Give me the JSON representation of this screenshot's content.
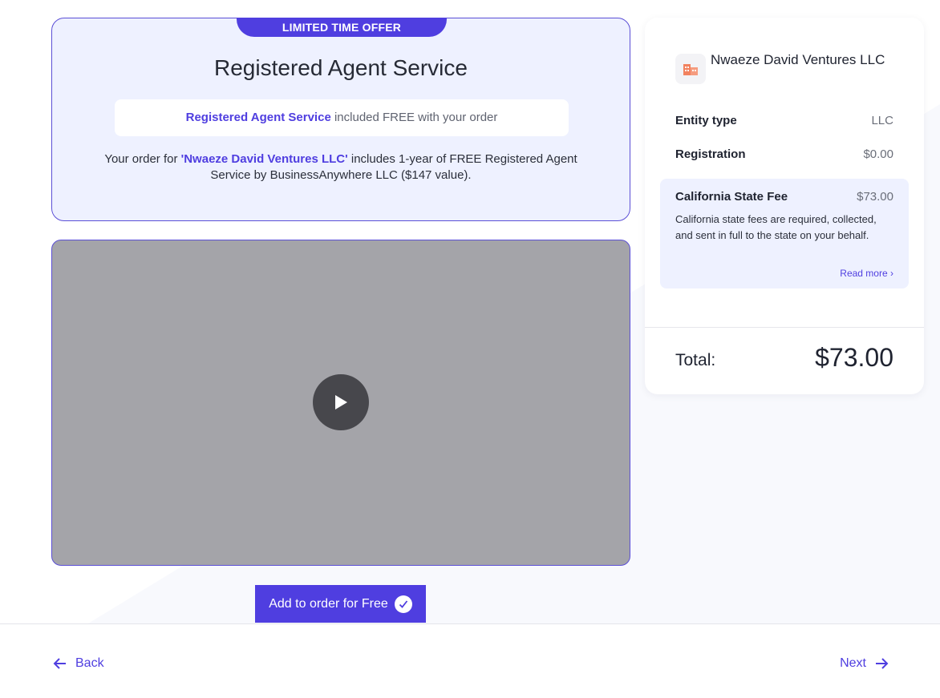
{
  "offer": {
    "ribbon": "LIMITED TIME OFFER",
    "title": "Registered Agent Service",
    "pill_highlight": "Registered Agent Service",
    "pill_rest": " included FREE with your order",
    "desc_before": "Your order for ",
    "desc_company": "'Nwaeze David Ventures LLC'",
    "desc_after": " includes 1-year of FREE Registered Agent Service by BusinessAnywhere LLC ($147 value)."
  },
  "video": {
    "play_icon": "play-icon"
  },
  "add_button": {
    "label": "Add to order for Free",
    "icon": "check-icon"
  },
  "summary": {
    "company_icon": "building-icon",
    "company_name": "Nwaeze David Ventures LLC",
    "rows": [
      {
        "label": "Entity type",
        "value": "LLC"
      },
      {
        "label": "Registration",
        "value": "$0.00"
      }
    ],
    "fee": {
      "label": "California State Fee",
      "value": "$73.00",
      "description": "California state fees are required, collected, and sent in full to the state on your behalf.",
      "read_more": "Read more"
    },
    "total_label": "Total:",
    "total_value": "$73.00"
  },
  "footer": {
    "back_label": "Back",
    "next_label": "Next"
  },
  "colors": {
    "accent": "#4f3ee0",
    "card_bg": "#eef1ff",
    "video_bg": "#a4a4a9"
  }
}
